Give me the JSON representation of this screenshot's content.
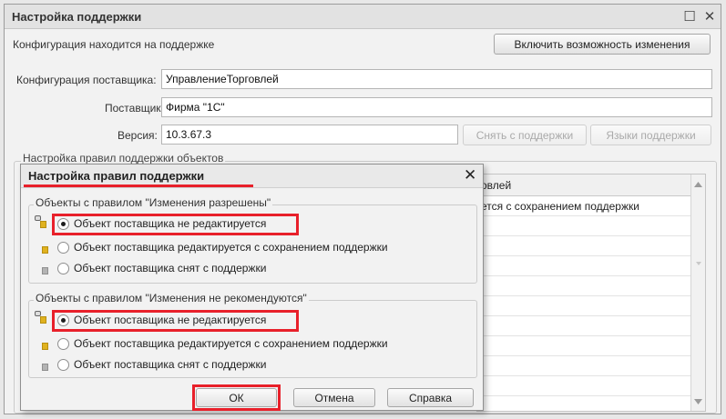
{
  "window": {
    "title": "Настройка поддержки",
    "maximize_glyph": "☐",
    "close_glyph": "✕"
  },
  "main": {
    "support_status": "Конфигурация находится на поддержке",
    "enable_changes_button": "Включить возможность изменения",
    "vendor_config_label": "Конфигурация поставщика:",
    "vendor_config_value": "УправлениеТорговлей",
    "vendor_label": "Поставщик:",
    "vendor_value": "Фирма \"1С\"",
    "version_label": "Версия:",
    "version_value": "10.3.67.3",
    "remove_support_button": "Снять с поддержки",
    "support_languages_button": "Языки поддержки",
    "rules_group_title": "Настройка правил поддержки объектов",
    "table": {
      "header_fragment": "овлей",
      "rows": [
        "ется с сохранением поддержки",
        "",
        "",
        "",
        "",
        "",
        "",
        "",
        "",
        ""
      ]
    }
  },
  "dialog": {
    "title": "Настройка правил поддержки",
    "close_glyph": "✕",
    "group1": {
      "title": "Объекты с правилом \"Изменения разрешены\"",
      "options": [
        {
          "label": "Объект поставщика не редактируется",
          "checked": true
        },
        {
          "label": "Объект поставщика редактируется с сохранением поддержки",
          "checked": false
        },
        {
          "label": "Объект поставщика снят с поддержки",
          "checked": false
        }
      ]
    },
    "group2": {
      "title": "Объекты с правилом \"Изменения не рекомендуются\"",
      "options": [
        {
          "label": "Объект поставщика не редактируется",
          "checked": true
        },
        {
          "label": "Объект поставщика редактируется с сохранением поддержки",
          "checked": false
        },
        {
          "label": "Объект поставщика снят с поддержки",
          "checked": false
        }
      ]
    },
    "ok_button": "ОК",
    "cancel_button": "Отмена",
    "help_button": "Справка"
  },
  "colors": {
    "highlight": "#e8202a",
    "support_cube": "#e0b21f",
    "removed_cube": "#b3b3b3"
  }
}
